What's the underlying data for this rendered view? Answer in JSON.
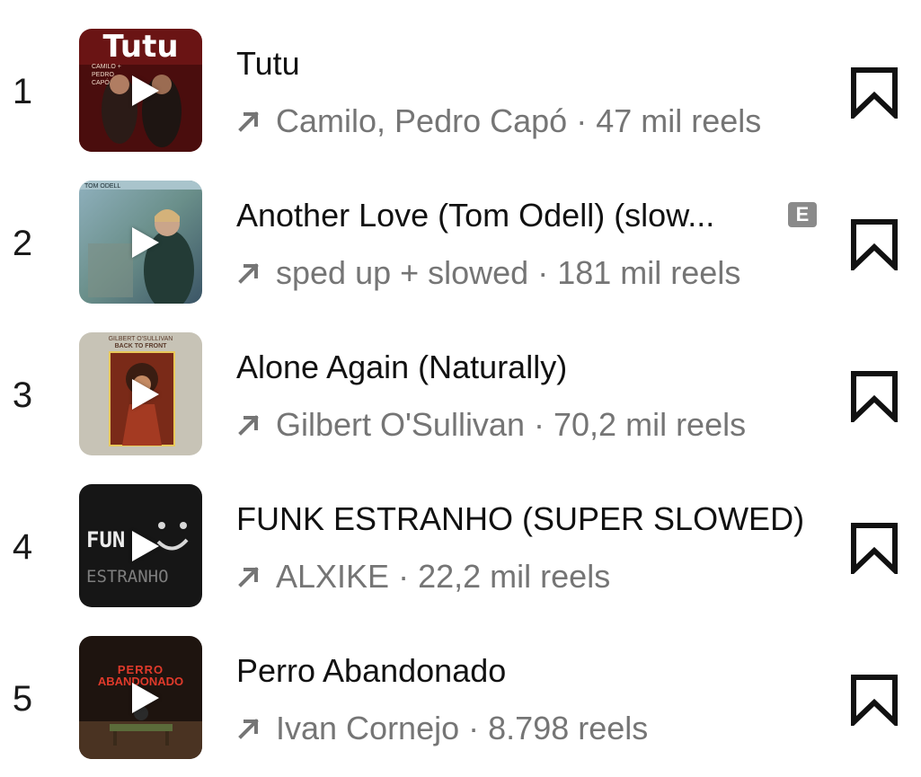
{
  "tracks": [
    {
      "rank": "1",
      "title": "Tutu",
      "artist": "Camilo, Pedro Capó",
      "separator": "·",
      "reels": "47 mil reels",
      "explicit": null,
      "cover": {
        "bg": "#6a1414",
        "title_text": "Tutu",
        "credits": "CAMILO + PEDRO CAPÓ"
      }
    },
    {
      "rank": "2",
      "title": "Another Love (Tom Odell) (slow...",
      "artist": "sped up + slowed",
      "separator": "·",
      "reels": "181 mil reels",
      "explicit": "E",
      "cover": {
        "bg": "#6f8c99",
        "label": "TOM ODELL"
      }
    },
    {
      "rank": "3",
      "title": "Alone Again (Naturally)",
      "artist": "Gilbert O'Sullivan",
      "separator": "·",
      "reels": "70,2 mil reels",
      "explicit": null,
      "cover": {
        "bg": "#c7c3b6",
        "artist_text": "GILBERT O'SULLIVAN",
        "album_text": "BACK TO FRONT"
      }
    },
    {
      "rank": "4",
      "title": "FUNK ESTRANHO (SUPER SLOWED)",
      "artist": "ALXIKE",
      "separator": "·",
      "reels": "22,2 mil reels",
      "explicit": null,
      "cover": {
        "bg": "#161616",
        "line1": "FUN",
        "line2": "ESTRANHO"
      }
    },
    {
      "rank": "5",
      "title": "Perro Abandonado",
      "artist": "Ivan Cornejo",
      "separator": "·",
      "reels": "8.798 reels",
      "explicit": null,
      "cover": {
        "bg": "#1e140f",
        "line1": "PERRO",
        "line2": "ABANDONADO",
        "accent": "#e03a2b"
      }
    }
  ],
  "colors": {
    "text_primary": "#111111",
    "text_secondary": "#757575",
    "explicit_badge": "#8a8a8a",
    "bookmark": "#111111"
  },
  "icons": {
    "trend": "arrow-up-right-icon",
    "save": "bookmark-icon",
    "play": "play-icon"
  }
}
